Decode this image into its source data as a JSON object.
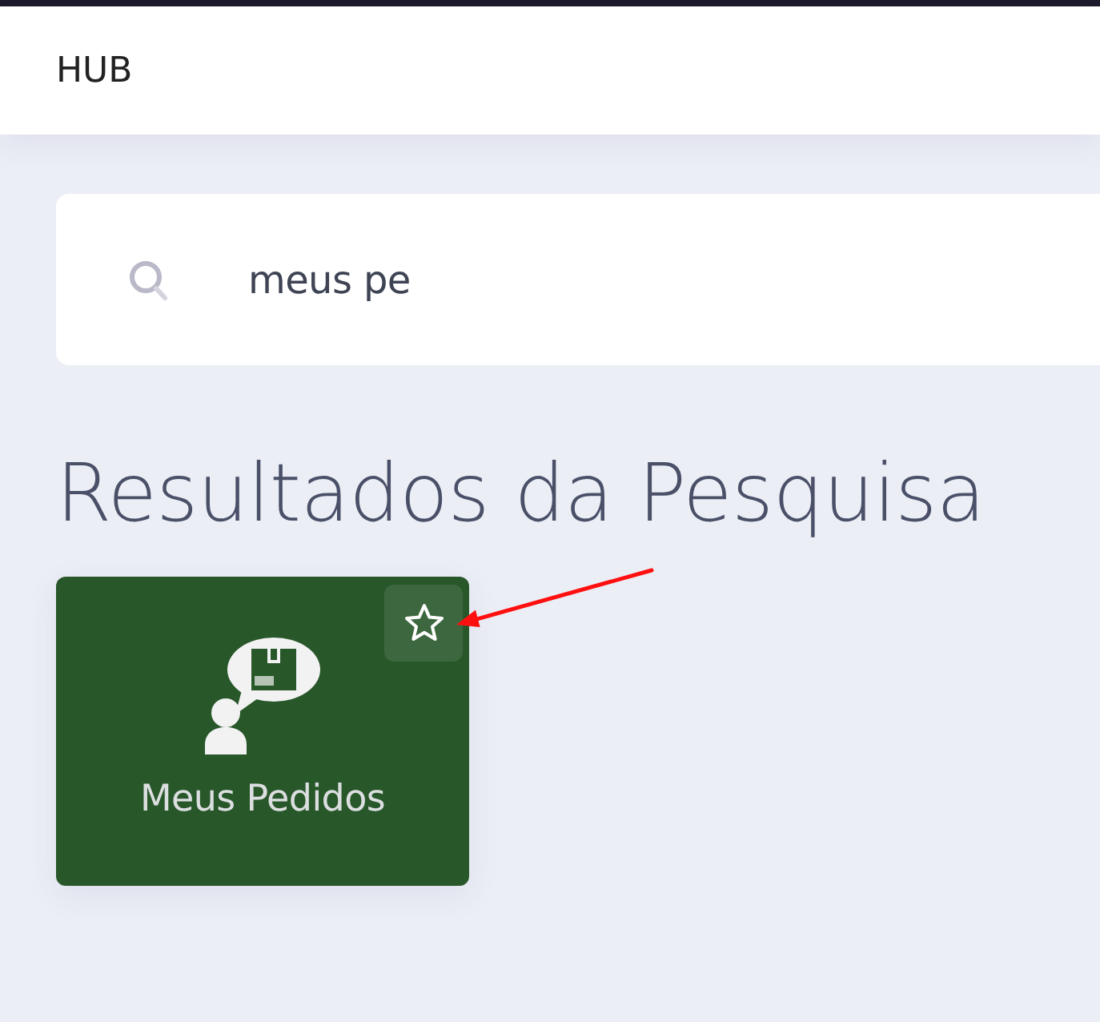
{
  "header": {
    "title": "HUB"
  },
  "search": {
    "value": "meus pe"
  },
  "results": {
    "heading": "Resultados da Pesquisa",
    "items": [
      {
        "label": "Meus Pedidos",
        "favorite": false
      }
    ]
  }
}
